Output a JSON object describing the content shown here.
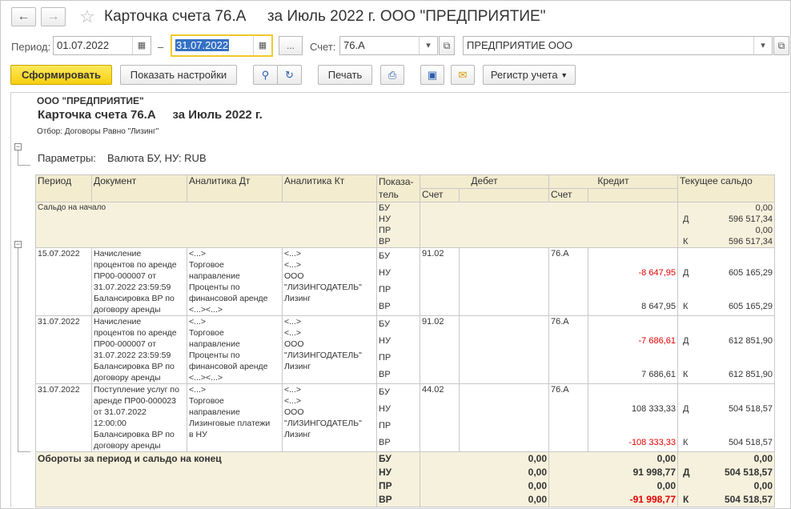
{
  "window": {
    "title": "Карточка счета 76.А     за Июль 2022 г. ООО \"ПРЕДПРИЯТИЕ\"",
    "back_icon": "←",
    "forward_icon": "→",
    "star_icon": "☆"
  },
  "filters": {
    "period_label": "Период:",
    "date_from": "01.07.2022",
    "dash": "–",
    "date_to": "31.07.2022",
    "ellipsis": "...",
    "account_label": "Счет:",
    "account": "76.А",
    "organization": "ПРЕДПРИЯТИЕ ООО"
  },
  "toolbar": {
    "generate": "Сформировать",
    "show_settings": "Показать настройки",
    "print": "Печать",
    "register": "Регистр учета"
  },
  "report": {
    "org": "ООО \"ПРЕДПРИЯТИЕ\"",
    "title": "Карточка счета 76.А     за Июль 2022 г.",
    "filter": "Отбор: Договоры Равно \"Лизинг\"",
    "params_label": "Параметры:",
    "params_value": "Валюта БУ, НУ: RUB",
    "headers": {
      "period": "Период",
      "document": "Документ",
      "analytics_dt": "Аналитика Дт",
      "analytics_kt": "Аналитика Кт",
      "indicator1": "Показа-",
      "indicator2": "тель",
      "debit": "Дебет",
      "credit": "Кредит",
      "balance": "Текущее сальдо",
      "account_dt": "Счет",
      "account_kt": "Счет"
    },
    "opening": {
      "label": "Сальдо на начало",
      "indicators": [
        "БУ",
        "НУ",
        "ПР",
        "ВР"
      ],
      "dk": [
        "",
        "Д",
        "",
        "К"
      ],
      "balances": [
        "0,00",
        "596 517,34",
        "0,00",
        "596 517,34"
      ]
    },
    "rows": [
      {
        "period": "15.07.2022",
        "document": [
          "Начисление",
          "процентов по аренде",
          "ПР00-000007 от",
          "31.07.2022 23:59:59",
          "Балансировка ВР по",
          "договору аренды"
        ],
        "analytics_dt": [
          "<...>",
          "Торговое",
          "направление",
          "Проценты по",
          "финансовой аренде",
          "<...><...>"
        ],
        "analytics_kt": [
          "<...>",
          "<...>",
          "ООО",
          "\"ЛИЗИНГОДАТЕЛЬ\"",
          "Лизинг"
        ],
        "indicators": [
          "БУ",
          "НУ",
          "ПР",
          "ВР"
        ],
        "account_dt": "91.02",
        "account_kt": "76.А",
        "credit": [
          "",
          "-8 647,95",
          "",
          "8 647,95"
        ],
        "dk": [
          "",
          "Д",
          "",
          "К"
        ],
        "balances": [
          "",
          "605 165,29",
          "",
          "605 165,29"
        ]
      },
      {
        "period": "31.07.2022",
        "document": [
          "Начисление",
          "процентов по аренде",
          "ПР00-000007 от",
          "31.07.2022 23:59:59",
          "Балансировка ВР по",
          "договору аренды"
        ],
        "analytics_dt": [
          "<...>",
          "Торговое",
          "направление",
          "Проценты по",
          "финансовой аренде",
          "<...><...>"
        ],
        "analytics_kt": [
          "<...>",
          "<...>",
          "ООО",
          "\"ЛИЗИНГОДАТЕЛЬ\"",
          "Лизинг"
        ],
        "indicators": [
          "БУ",
          "НУ",
          "ПР",
          "ВР"
        ],
        "account_dt": "91.02",
        "account_kt": "76.А",
        "credit": [
          "",
          "-7 686,61",
          "",
          "7 686,61"
        ],
        "dk": [
          "",
          "Д",
          "",
          "К"
        ],
        "balances": [
          "",
          "612 851,90",
          "",
          "612 851,90"
        ]
      },
      {
        "period": "31.07.2022",
        "document": [
          "Поступление услуг по",
          "аренде ПР00-000023",
          "от 31.07.2022",
          "12:00:00",
          "Балансировка ВР по",
          "договору аренды"
        ],
        "analytics_dt": [
          "<...>",
          "Торговое",
          "направление",
          "Лизинговые платежи",
          "в НУ"
        ],
        "analytics_kt": [
          "<...>",
          "<...>",
          "ООО",
          "\"ЛИЗИНГОДАТЕЛЬ\"",
          "Лизинг"
        ],
        "indicators": [
          "БУ",
          "НУ",
          "ПР",
          "ВР"
        ],
        "account_dt": "44.02",
        "account_kt": "76.А",
        "credit": [
          "",
          "108 333,33",
          "",
          "-108 333,33"
        ],
        "dk": [
          "",
          "Д",
          "",
          "К"
        ],
        "balances": [
          "",
          "504 518,57",
          "",
          "504 518,57"
        ]
      }
    ],
    "totals": {
      "label": "Обороты за период и сальдо на конец",
      "indicators": [
        "БУ",
        "НУ",
        "ПР",
        "ВР"
      ],
      "debit": [
        "0,00",
        "0,00",
        "0,00",
        "0,00"
      ],
      "credit": [
        "0,00",
        "91 998,77",
        "0,00",
        "-91 998,77"
      ],
      "dk": [
        "",
        "Д",
        "",
        "К"
      ],
      "balances": [
        "0,00",
        "504 518,57",
        "0,00",
        "504 518,57"
      ]
    }
  },
  "colors": {
    "accent_yellow": "#f7cf10",
    "header_beige": "#f3eccf",
    "negative_red": "#e00000",
    "selection_blue": "#3470c4"
  }
}
